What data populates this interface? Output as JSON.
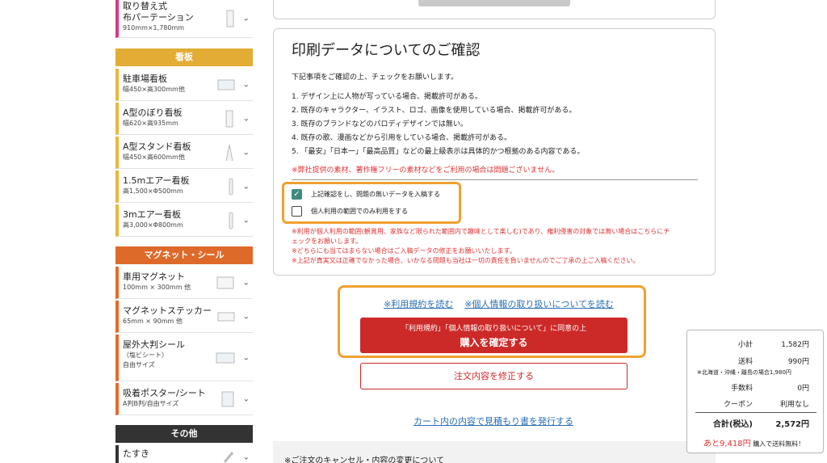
{
  "sidebar": {
    "items": [
      {
        "title": "取り替え式",
        "title2": "布パーテーション",
        "sub": "910mm×1,780mm"
      },
      {
        "title": "駐車場看板",
        "sub": "幅450×高300mm他"
      },
      {
        "title": "A型のぼり看板",
        "sub": "幅620×高935mm"
      },
      {
        "title": "A型スタンド看板",
        "sub": "幅450×高600mm他"
      },
      {
        "title": "1.5mエアー看板",
        "sub": "高1,500×Φ500mm"
      },
      {
        "title": "3mエアー看板",
        "sub": "高3,000×Φ800mm"
      },
      {
        "title": "車用マグネット",
        "sub": "100mm × 300mm 他"
      },
      {
        "title": "マグネットステッカー",
        "sub": "65mm × 90mm 他"
      },
      {
        "title": "屋外大判シール",
        "title2": "（塩ビシート）",
        "sub": "自由サイズ"
      },
      {
        "title": "吸着ポスター/シート",
        "sub": "A判B判/自由サイズ"
      },
      {
        "title": "たすき",
        "sub": ""
      }
    ],
    "categories": {
      "signboard": "看板",
      "magnet": "マグネット・シール",
      "other": "その他"
    }
  },
  "panel": {
    "title": "印刷データについてのご確認",
    "intro": "下記事項をご確認の上、チェックをお願いします。",
    "list": [
      "1. デザイン上に人物が写っている場合、掲載許可がある。",
      "2. 既存のキャラクター、イラスト、ロゴ、画像を使用している場合、掲載許可がある。",
      "3. 既存のブランドなどのパロディデザインでは無い。",
      "4. 既存の歌、漫画などから引用をしている場合、掲載許可がある。",
      "5. 「最安」「日本一」「最高品質」などの最上級表示は具体的かつ根拠のある内容である。"
    ],
    "red_note": "※弊社提供の素材、著作権フリーの素材などをご利用の場合は問題ございません。",
    "check1": "上記確認をし、問題の無いデータを入稿する",
    "check2": "個人利用の範囲でのみ利用をする",
    "notes": [
      "※利用が個人利用の範囲(観賞用、家族など限られた範囲内で趣味として楽しむ)であり、権利侵害の対象では無い場合はこちらにチ",
      "ェックをお願いします。",
      "※どちらにも当てはまらない場合はご入稿データの修正をお願いいたします。",
      "※上記が真実又は正確でなかった場合、いかなる問題も当社は一切の責任を負いませんのでご了承の上ご入稿ください。"
    ]
  },
  "purchase": {
    "terms_link": "※利用規約を読む",
    "privacy_link": "※個人情報の取り扱いについてを読む",
    "confirm_small": "「利用規約」「個人情報の取り扱いについて」に同意の上",
    "confirm_big": "購入を確定する",
    "modify": "注文内容を修正する",
    "estimate": "カート内の内容で見積もり書を発行する"
  },
  "bottom": {
    "cancel_title": "※ご注文のキャンセル・内容の変更について"
  },
  "summary": {
    "subtotal_label": "小計",
    "subtotal": "1,582円",
    "shipping_label": "送料",
    "shipping": "990円",
    "shipping_note": "※北海道・沖縄・離島の場合1,980円",
    "fee_label": "手数料",
    "fee": "0円",
    "coupon_label": "クーポン",
    "coupon": "利用なし",
    "total_label": "合計(税込)",
    "total": "2,572円",
    "free_amount": "あと9,418円",
    "free_text": "購入で送料無料！"
  }
}
